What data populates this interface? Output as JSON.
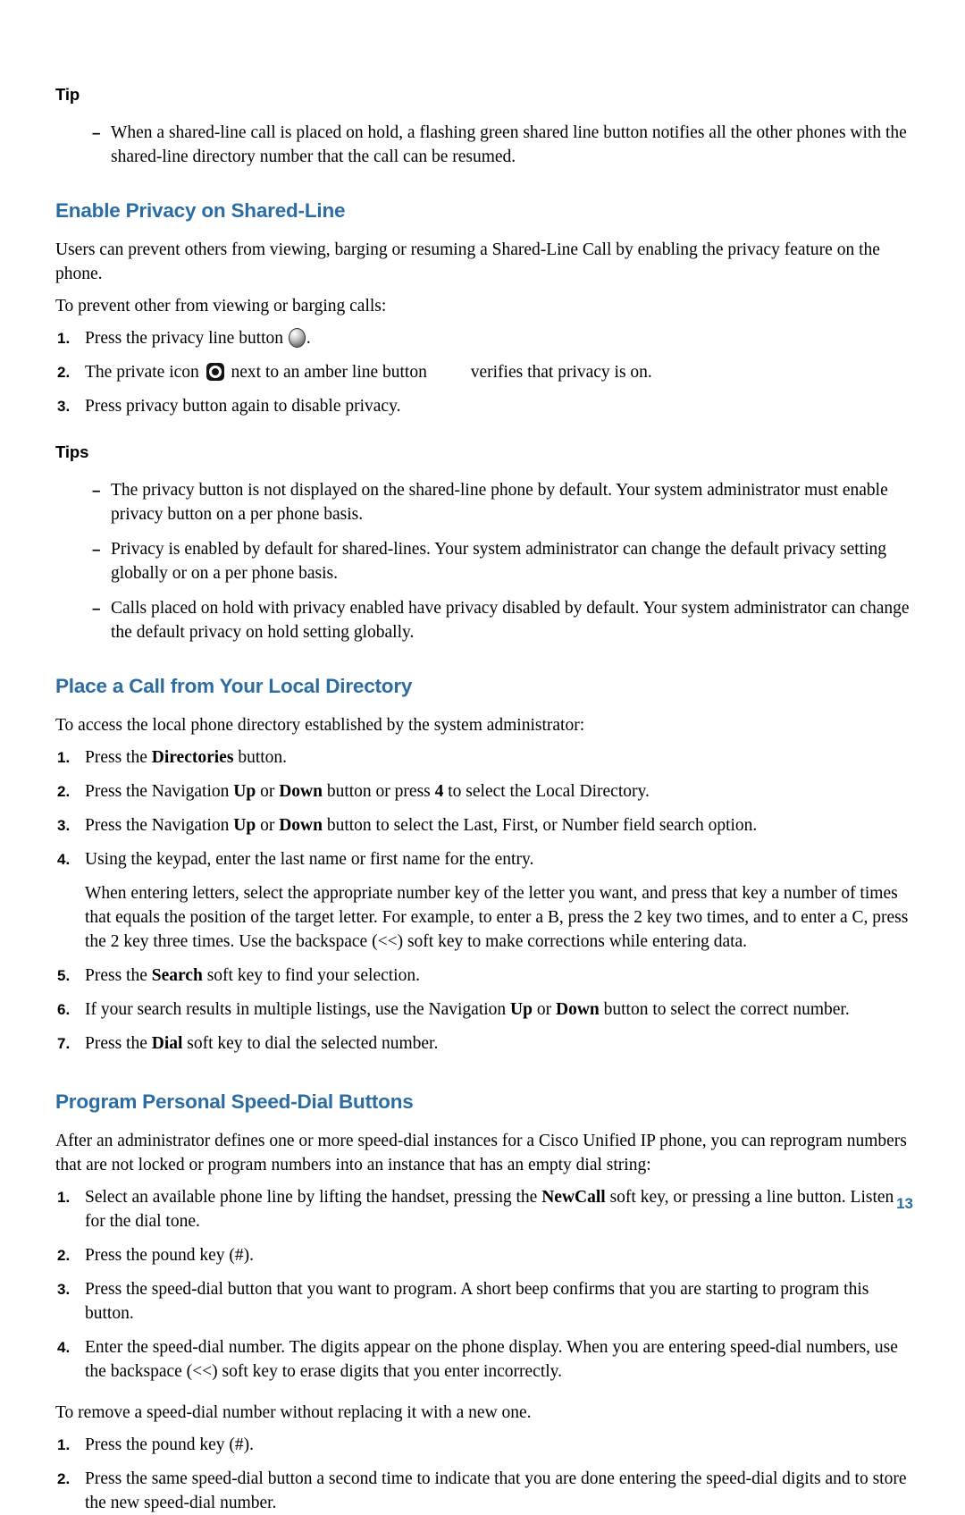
{
  "page": {
    "number": "13"
  },
  "tip_block": {
    "label": "Tip",
    "items": [
      "When a shared-line call is placed on hold, a flashing green shared line button notifies all the other phones with the shared-line directory number that the call can be resumed."
    ]
  },
  "section_privacy": {
    "heading": "Enable Privacy on Shared-Line",
    "intro": "Users can prevent others from viewing, barging or resuming a Shared-Line Call by enabling the privacy feature on the phone.",
    "lead_in": "To prevent other from viewing or barging calls:",
    "steps": [
      {
        "number": "1.",
        "text_before": "Press the privacy line button ",
        "icon": "line-button-icon",
        "text_after": "."
      },
      {
        "number": "2.",
        "text_before": "The private icon ",
        "icon": "private-icon",
        "text_middle": " next to an amber line button ",
        "icon2": "amber-line-button-icon",
        "text_after": "verifies that privacy is on."
      },
      {
        "number": "3.",
        "text_before": "Press privacy button again to disable privacy."
      }
    ],
    "tips_label": "Tips",
    "tips": [
      "The privacy button is not displayed on the shared-line phone by default. Your system administrator must enable privacy button on a per phone basis.",
      "Privacy is enabled by default for shared-lines. Your system administrator can change the default privacy setting globally or on a per phone basis.",
      "Calls placed on hold with privacy enabled have privacy disabled by default. Your system administrator can change the default privacy on hold setting globally."
    ]
  },
  "section_directory": {
    "heading": "Place a Call from Your Local Directory",
    "lead_in": "To access the local phone directory established by the system administrator:",
    "steps": [
      {
        "number": "1.",
        "parts": [
          {
            "t": "Press the ",
            "b": false
          },
          {
            "t": "Directories",
            "b": true
          },
          {
            "t": " button.",
            "b": false
          }
        ]
      },
      {
        "number": "2.",
        "parts": [
          {
            "t": "Press the Navigation ",
            "b": false
          },
          {
            "t": "Up",
            "b": true
          },
          {
            "t": " or ",
            "b": false
          },
          {
            "t": "Down",
            "b": true
          },
          {
            "t": " button or press ",
            "b": false
          },
          {
            "t": "4",
            "b": true
          },
          {
            "t": " to select the Local Directory.",
            "b": false
          }
        ]
      },
      {
        "number": "3.",
        "parts": [
          {
            "t": "Press the Navigation ",
            "b": false
          },
          {
            "t": "Up",
            "b": true
          },
          {
            "t": " or ",
            "b": false
          },
          {
            "t": "Down",
            "b": true
          },
          {
            "t": " button to select the Last, First, or Number field search option.",
            "b": false
          }
        ]
      },
      {
        "number": "4.",
        "parts": [
          {
            "t": "Using the keypad, enter the last name or first name for the entry.",
            "b": false
          }
        ]
      }
    ],
    "note": "When entering letters, select the appropriate number key of the letter you want, and press that key a number of times that equals the position of the target letter. For example, to enter a B, press the 2 key two times, and to enter a C, press the 2 key three times. Use the backspace (<<) soft key to make corrections while entering data.",
    "steps2": [
      {
        "number": "5.",
        "parts": [
          {
            "t": "Press the ",
            "b": false
          },
          {
            "t": "Search",
            "b": true
          },
          {
            "t": " soft key to find your selection.",
            "b": false
          }
        ]
      },
      {
        "number": "6.",
        "parts": [
          {
            "t": "If your search results in multiple listings, use the Navigation ",
            "b": false
          },
          {
            "t": "Up",
            "b": true
          },
          {
            "t": " or ",
            "b": false
          },
          {
            "t": "Down",
            "b": true
          },
          {
            "t": " button to select the correct number.",
            "b": false
          }
        ]
      },
      {
        "number": "7.",
        "parts": [
          {
            "t": "Press the ",
            "b": false
          },
          {
            "t": "Dial",
            "b": true
          },
          {
            "t": " soft key to dial the selected number.",
            "b": false
          }
        ]
      }
    ]
  },
  "section_speeddial": {
    "heading": "Program Personal Speed-Dial Buttons",
    "intro": "After an administrator defines one or more speed-dial instances for a Cisco Unified IP phone, you can reprogram numbers that are not locked or program numbers into an instance that has an empty dial string:",
    "steps": [
      {
        "number": "1.",
        "parts": [
          {
            "t": "Select an available phone line by lifting the handset, pressing the ",
            "b": false
          },
          {
            "t": "NewCall",
            "b": true
          },
          {
            "t": " soft key, or pressing a line button. Listen for the dial tone.",
            "b": false
          }
        ]
      },
      {
        "number": "2.",
        "parts": [
          {
            "t": "Press the pound key (#).",
            "b": false
          }
        ]
      },
      {
        "number": "3.",
        "parts": [
          {
            "t": "Press the speed-dial button that you want to program. A short beep confirms that you are starting to program this button.",
            "b": false
          }
        ]
      },
      {
        "number": "4.",
        "parts": [
          {
            "t": "Enter the speed-dial number. The digits appear on the phone display. When you are entering speed-dial numbers, use the backspace (<<) soft key to erase digits that you enter incorrectly.",
            "b": false
          }
        ]
      }
    ],
    "remove_lead_in": "To remove a speed-dial number without replacing it with a new one.",
    "remove_steps": [
      {
        "number": "1.",
        "parts": [
          {
            "t": "Press the pound key (#).",
            "b": false
          }
        ]
      },
      {
        "number": "2.",
        "parts": [
          {
            "t": "Press the same speed-dial button a second time to indicate that you are done entering the speed-dial digits and to store the new speed-dial number.",
            "b": false
          }
        ]
      }
    ]
  }
}
